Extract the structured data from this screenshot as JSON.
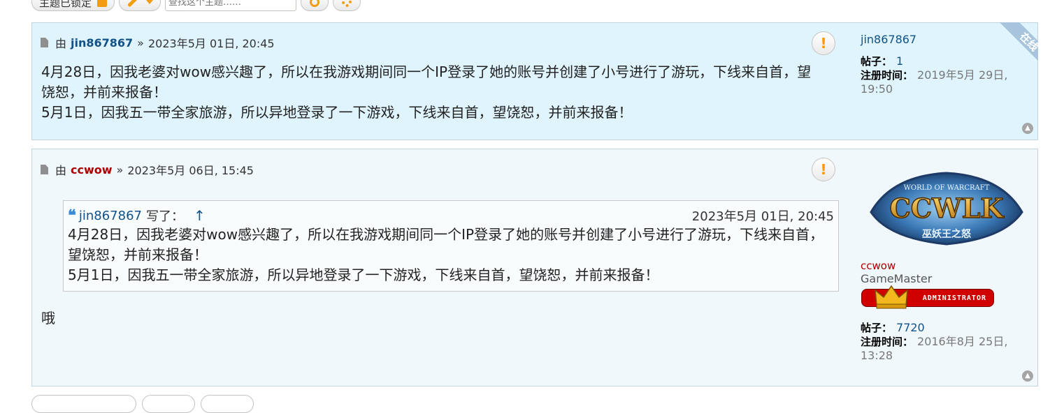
{
  "toolbar": {
    "locked_label": "主题已锁定",
    "search_placeholder": "查找这个主题……"
  },
  "posts": [
    {
      "by": "由",
      "author": "jin867867",
      "sep": "»",
      "date": "2023年5月 01日, 20:45",
      "report_icon": "!",
      "content": [
        "4月28日，因我老婆对wow感兴趣了，所以在我游戏期间同一个IP登录了她的账号并创建了小号进行了游玩，下线来自首，望饶恕，并前来报备！",
        "5月1日，因我五一带全家旅游，所以异地登录了一下游戏，下线来自首，望饶恕，并前来报备！"
      ],
      "profile": {
        "username": "jin867867",
        "posts_label": "帖子：",
        "posts_value": "1",
        "joined_label": "注册时间：",
        "joined_value": "2019年5月 29日, 19:50",
        "online_ribbon": "在线"
      }
    },
    {
      "by": "由",
      "author": "ccwow",
      "sep": "»",
      "date": "2023年5月 06日, 15:45",
      "report_icon": "!",
      "quote": {
        "author": "jin867867",
        "wrote": "写了：",
        "up_arrow": "↑",
        "date": "2023年5月 01日, 20:45",
        "lines": [
          "4月28日，因我老婆对wow感兴趣了，所以在我游戏期间同一个IP登录了她的账号并创建了小号进行了游玩，下线来自首，望饶恕，并前来报备！",
          "5月1日，因我五一带全家旅游，所以异地登录了一下游戏，下线来自首，望饶恕，并前来报备！"
        ]
      },
      "content": [
        "哦"
      ],
      "profile": {
        "username": "ccwow",
        "rank": "GameMaster",
        "badge_text": "ADMINISTRATOR",
        "avatar_text": "CCWLK",
        "avatar_top_text": "WORLD OF WARCRAFT",
        "avatar_bottom_text": "巫妖王之怒",
        "posts_label": "帖子：",
        "posts_value": "7720",
        "joined_label": "注册时间：",
        "joined_value": "2016年8月 25日, 13:28"
      }
    }
  ],
  "icons": {
    "lock": "lock-icon",
    "wrench": "wrench-icon",
    "search": "search-icon",
    "gear": "gear-icon",
    "doc": "post-icon",
    "quote": "quote-icon",
    "top": "back-to-top-icon"
  },
  "colors": {
    "accent": "#f39c12",
    "link": "#105289",
    "admin": "#aa0000",
    "post_bg_1": "#dff4fd",
    "post_bg_2": "#f1f8fb"
  }
}
